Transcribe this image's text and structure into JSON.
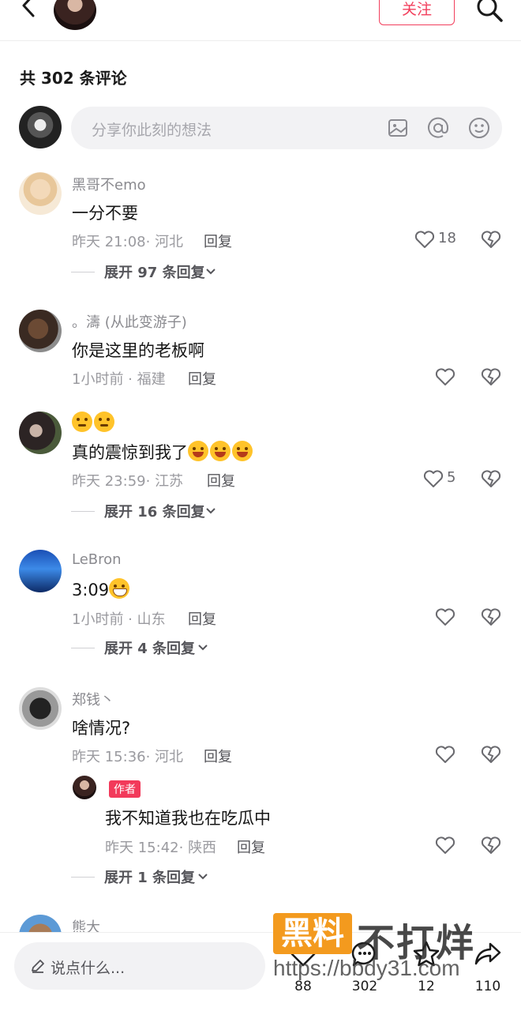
{
  "header": {
    "follow_label": "关注"
  },
  "comments_header": {
    "count_label": "共 302 条评论"
  },
  "share_input": {
    "placeholder": "分享你此刻的想法"
  },
  "comments": [
    {
      "username": "黑哥不emo",
      "content": "一分不要",
      "time": "昨天 21:08",
      "location": "河北",
      "reply_label": "回复",
      "likes": "18",
      "expand_label": "展开 97 条回复"
    },
    {
      "username": "。濤 (从此变游子)",
      "content": "你是这里的老板啊",
      "time": "1小时前",
      "location": "福建",
      "reply_label": "回复",
      "likes": ""
    },
    {
      "username_emojis": "🤔🤔",
      "content": "真的震惊到我了",
      "content_emojis": "😂😂😂",
      "time": "昨天 23:59",
      "location": "江苏",
      "reply_label": "回复",
      "likes": "5",
      "expand_label": "展开 16 条回复"
    },
    {
      "username": "LeBron",
      "content": "3:09",
      "content_emojis": "😁",
      "time": "1小时前",
      "location": "山东",
      "reply_label": "回复",
      "likes": "",
      "expand_label": "展开 4 条回复"
    },
    {
      "username": "郑钱丶",
      "content": "啥情况?",
      "time": "昨天 15:36",
      "location": "河北",
      "reply_label": "回复",
      "likes": "",
      "reply": {
        "badge": "作者",
        "content": "我不知道我也在吃瓜中",
        "time": "昨天 15:42",
        "location": "陕西",
        "reply_label": "回复"
      },
      "expand_label": "展开 1 条回复"
    },
    {
      "username": "熊大"
    }
  ],
  "bottom_bar": {
    "placeholder": "说点什么...",
    "likes": "88",
    "comments": "302",
    "favorites": "12",
    "shares": "110"
  },
  "watermark": {
    "box_text": "黑料",
    "text": "不打烊",
    "url": "https://bbdy31.com"
  },
  "colors": {
    "accent": "#f23f5c",
    "badge": "#f2395a",
    "watermark_orange": "#f39a1e"
  }
}
